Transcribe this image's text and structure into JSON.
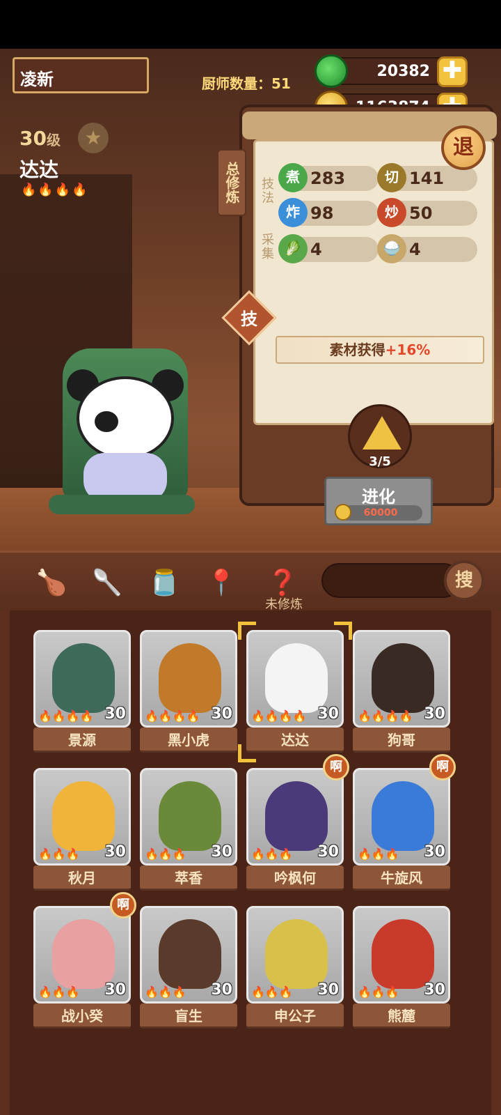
{
  "player": {
    "name": "凌新",
    "chef_count_label": "厨师数量：",
    "chef_count": "51"
  },
  "currency": {
    "jade": "20382",
    "coins": "1163874",
    "plus": "✚"
  },
  "chef": {
    "level": "30",
    "level_unit": "级",
    "name": "达达",
    "flames": "🔥🔥🔥🔥"
  },
  "panel": {
    "tab_vertical": "总修炼",
    "skills_label": "技法",
    "gather_label": "采集",
    "stats": [
      {
        "icon": "煮",
        "value": "283",
        "color": "#4aa84a"
      },
      {
        "icon": "切",
        "value": "141",
        "color": "#9a7a2a"
      },
      {
        "icon": "炸",
        "value": "98",
        "color": "#3b8fd8"
      },
      {
        "icon": "炒",
        "value": "50",
        "color": "#c84a2a"
      },
      {
        "icon": "🥬",
        "value": "4",
        "color": "#5aa84a"
      },
      {
        "icon": "🍚",
        "value": "4",
        "color": "#c8a86a"
      }
    ],
    "exit": "退",
    "skill_btn": "技",
    "bonus_text": "素材获得",
    "bonus_pct": "+16%",
    "evolve_progress": "3/5",
    "evolve_label": "进化",
    "evolve_cost": "60000"
  },
  "filters": {
    "active_label": "未修炼",
    "search_icon": "搜"
  },
  "cards": [
    {
      "name": "景源",
      "level": "30",
      "flames": "🔥🔥🔥🔥",
      "color": "#3e6a5a",
      "tag": ""
    },
    {
      "name": "黑小虎",
      "level": "30",
      "flames": "🔥🔥🔥🔥",
      "color": "#c07a2a",
      "tag": ""
    },
    {
      "name": "达达",
      "level": "30",
      "flames": "🔥🔥🔥🔥",
      "color": "#f4f4f4",
      "tag": ""
    },
    {
      "name": "狗哥",
      "level": "30",
      "flames": "🔥🔥🔥🔥",
      "color": "#3a2a24",
      "tag": ""
    },
    {
      "name": "秋月",
      "level": "30",
      "flames": "🔥🔥🔥",
      "color": "#f0b43a",
      "tag": ""
    },
    {
      "name": "萃香",
      "level": "30",
      "flames": "🔥🔥🔥",
      "color": "#6a8a3a",
      "tag": ""
    },
    {
      "name": "吟枫何",
      "level": "30",
      "flames": "🔥🔥🔥",
      "color": "#4a3a7a",
      "tag": "啊"
    },
    {
      "name": "牛旋风",
      "level": "30",
      "flames": "🔥🔥🔥",
      "color": "#3a7ad8",
      "tag": "啊"
    },
    {
      "name": "战小癸",
      "level": "30",
      "flames": "🔥🔥🔥",
      "color": "#e8a0a0",
      "tag": "啊"
    },
    {
      "name": "盲生",
      "level": "30",
      "flames": "🔥🔥🔥",
      "color": "#5a3a2a",
      "tag": ""
    },
    {
      "name": "申公子",
      "level": "30",
      "flames": "🔥🔥🔥",
      "color": "#d8c04a",
      "tag": ""
    },
    {
      "name": "熊麓",
      "level": "30",
      "flames": "🔥🔥🔥",
      "color": "#c83a2a",
      "tag": ""
    }
  ]
}
